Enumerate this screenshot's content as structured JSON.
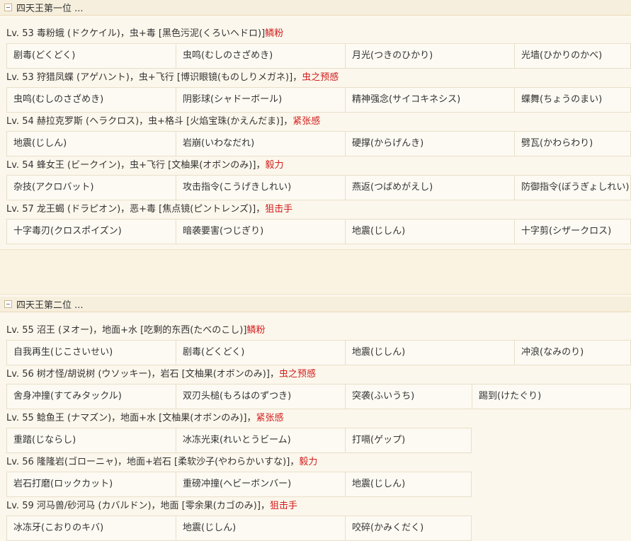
{
  "sections": [
    {
      "title": "四天王第一位 ...",
      "pokemon": [
        {
          "info": "Lv. 53 毒粉蛾 (ドクケイル)，虫+毒 [黑色污泥(くろいヘドロ)]",
          "ability": "鳞粉",
          "moves": [
            "剧毒(どくどく)",
            "虫鸣(むしのさざめき)",
            "月光(つきのひかり)",
            "光墙(ひかりのかべ)"
          ]
        },
        {
          "info": "Lv. 53 狩猎凤蝶 (アゲハント)，虫+飞行 [博识眼镜(ものしりメガネ)]，",
          "ability": "虫之预感",
          "moves": [
            "虫鸣(むしのさざめき)",
            "阴影球(シャドーボール)",
            "精神强念(サイコキネシス)",
            "蝶舞(ちょうのまい)"
          ]
        },
        {
          "info": "Lv. 54 赫拉克罗斯 (ヘラクロス)，虫+格斗 [火焰宝珠(かえんだま)]，",
          "ability": "紧张感",
          "moves": [
            "地震(じしん)",
            "岩崩(いわなだれ)",
            "硬撑(からげんき)",
            "劈瓦(かわらわり)"
          ]
        },
        {
          "info": "Lv. 54 蜂女王 (ビークイン)，虫+飞行 [文柚果(オボンのみ)]，",
          "ability": "毅力",
          "moves": [
            "杂技(アクロバット)",
            "攻击指令(こうげきしれい)",
            "燕返(つばめがえし)",
            "防御指令(ぼうぎょしれい)"
          ]
        },
        {
          "info": "Lv. 57 龙王蝎 (ドラピオン)，恶+毒 [焦点镜(ピントレンズ)]，",
          "ability": "狙击手",
          "moves": [
            "十字毒刃(クロスポイズン)",
            "暗袭要害(つじぎり)",
            "地震(じしん)",
            "十字剪(シザークロス)"
          ]
        }
      ]
    },
    {
      "title": "四天王第二位 ...",
      "pokemon": [
        {
          "info": "Lv. 55 沼王 (ヌオー)，地面+水 [吃剩的东西(たべのこし)]",
          "ability": "鳞粉",
          "moves": [
            "自我再生(じこさいせい)",
            "剧毒(どくどく)",
            "地震(じしん)",
            "冲浪(なみのり)"
          ]
        },
        {
          "info": "Lv. 56 树才怪/胡说树 (ウソッキー)，岩石 [文柚果(オボンのみ)]，",
          "ability": "虫之预感",
          "moves": [
            "舍身冲撞(すてみタックル)",
            "双刃头槌(もろはのずつき)",
            "突袭(ふいうち)",
            "踢到(けたぐり)"
          ]
        },
        {
          "info": "Lv. 55 鲶鱼王 (ナマズン)，地面+水 [文柚果(オボンのみ)]，",
          "ability": "紧张感",
          "moves": [
            "重踏(じならし)",
            "冰冻光束(れいとうビーム)",
            "打嗝(ゲップ)"
          ]
        },
        {
          "info": "Lv. 56 隆隆岩(ゴローニャ)，地面+岩石 [柔软沙子(やわらかいすな)]，",
          "ability": "毅力",
          "moves": [
            "岩石打磨(ロックカット)",
            "重磅冲撞(ヘビーボンバー)",
            "地震(じしん)"
          ]
        },
        {
          "info": "Lv. 59 河马兽/砂河马 (カバルドン)，地面 [零余果(カゴのみ)]，",
          "ability": "狙击手",
          "moves": [
            "冰冻牙(こおりのキバ)",
            "地震(じしん)",
            "咬碎(かみくだく)"
          ]
        }
      ]
    }
  ]
}
